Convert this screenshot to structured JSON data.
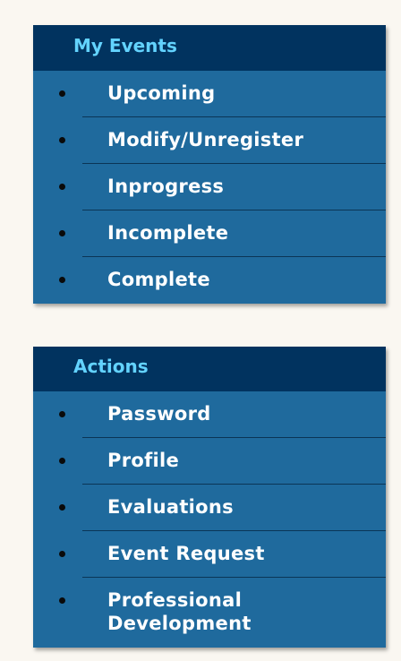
{
  "my_events": {
    "title": "My Events",
    "items": [
      {
        "label": "Upcoming"
      },
      {
        "label": "Modify/Unregister"
      },
      {
        "label": "Inprogress"
      },
      {
        "label": "Incomplete"
      },
      {
        "label": "Complete"
      }
    ]
  },
  "actions": {
    "title": "Actions",
    "items": [
      {
        "label": "Password"
      },
      {
        "label": "Profile"
      },
      {
        "label": "Evaluations"
      },
      {
        "label": "Event Request"
      },
      {
        "label": "Professional Development"
      }
    ]
  },
  "colors": {
    "header_bg": "#01335f",
    "header_text": "#63d3ff",
    "panel_bg": "#1f6a9d",
    "item_text": "#ffffff",
    "page_bg": "#faf7f1"
  }
}
